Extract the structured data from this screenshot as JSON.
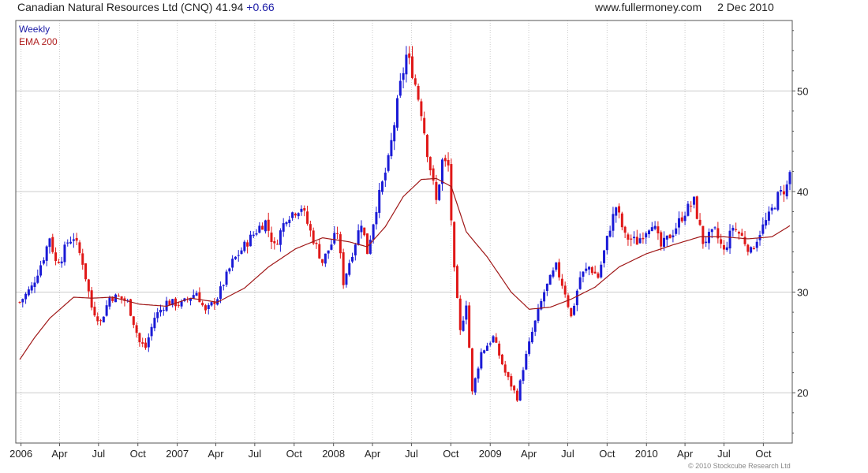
{
  "header": {
    "title": "Canadian Natural Resources Ltd (CNQ)",
    "price": "41.94",
    "change": "+0.66",
    "website": "www.fullermoney.com",
    "date": "2 Dec 2010"
  },
  "legend": {
    "weekly": "Weekly",
    "ema": "EMA 200"
  },
  "copyright": "© 2010 Stockcube Research Ltd",
  "colors": {
    "up": "#1a1ad6",
    "down": "#e01818",
    "ema": "#a01818",
    "grid": "#cccccc",
    "frame": "#555555"
  },
  "chart_data": {
    "type": "candlestick",
    "interval": "weekly",
    "x_range": [
      "2005-12-29",
      "2010-12-02"
    ],
    "ylim": [
      15,
      57
    ],
    "y_ticks": [
      20,
      30,
      40,
      50
    ],
    "y_axis_side": "right",
    "grid": true,
    "legend_position": "top-left",
    "x_ticks": [
      {
        "label": "2006",
        "date": "2006-01-01"
      },
      {
        "label": "Apr",
        "date": "2006-04-01"
      },
      {
        "label": "Jul",
        "date": "2006-07-01"
      },
      {
        "label": "Oct",
        "date": "2006-10-01"
      },
      {
        "label": "2007",
        "date": "2007-01-01"
      },
      {
        "label": "Apr",
        "date": "2007-04-01"
      },
      {
        "label": "Jul",
        "date": "2007-07-01"
      },
      {
        "label": "Oct",
        "date": "2007-10-01"
      },
      {
        "label": "2008",
        "date": "2008-01-01"
      },
      {
        "label": "Apr",
        "date": "2008-04-01"
      },
      {
        "label": "Jul",
        "date": "2008-07-01"
      },
      {
        "label": "Oct",
        "date": "2008-10-01"
      },
      {
        "label": "2009",
        "date": "2009-01-01"
      },
      {
        "label": "Apr",
        "date": "2009-04-01"
      },
      {
        "label": "Jul",
        "date": "2009-07-01"
      },
      {
        "label": "Oct",
        "date": "2009-10-01"
      },
      {
        "label": "2010",
        "date": "2010-01-01"
      },
      {
        "label": "Apr",
        "date": "2010-04-01"
      },
      {
        "label": "Jul",
        "date": "2010-07-01"
      },
      {
        "label": "Oct",
        "date": "2010-10-01"
      }
    ],
    "series": [
      {
        "name": "Weekly",
        "close_keypoints": [
          [
            "2005-12-29",
            29.0
          ],
          [
            "2006-01-26",
            30.5
          ],
          [
            "2006-02-23",
            33.5
          ],
          [
            "2006-03-09",
            35.5
          ],
          [
            "2006-03-23",
            33.0
          ],
          [
            "2006-04-06",
            33.5
          ],
          [
            "2006-04-20",
            35.0
          ],
          [
            "2006-05-04",
            35.5
          ],
          [
            "2006-05-25",
            33.0
          ],
          [
            "2006-06-15",
            28.5
          ],
          [
            "2006-07-06",
            27.0
          ],
          [
            "2006-07-27",
            29.5
          ],
          [
            "2006-08-17",
            29.5
          ],
          [
            "2006-09-07",
            29.0
          ],
          [
            "2006-09-21",
            27.0
          ],
          [
            "2006-10-05",
            25.0
          ],
          [
            "2006-10-19",
            24.5
          ],
          [
            "2006-11-09",
            27.5
          ],
          [
            "2006-12-07",
            29.0
          ],
          [
            "2007-01-11",
            28.8
          ],
          [
            "2007-02-15",
            30.0
          ],
          [
            "2007-03-08",
            28.0
          ],
          [
            "2007-04-05",
            29.5
          ],
          [
            "2007-05-10",
            33.0
          ],
          [
            "2007-06-14",
            35.0
          ],
          [
            "2007-07-12",
            36.5
          ],
          [
            "2007-07-26",
            37.0
          ],
          [
            "2007-08-16",
            34.5
          ],
          [
            "2007-09-13",
            37.5
          ],
          [
            "2007-10-18",
            38.5
          ],
          [
            "2007-11-08",
            36.0
          ],
          [
            "2007-12-06",
            33.0
          ],
          [
            "2008-01-10",
            36.0
          ],
          [
            "2008-01-24",
            31.0
          ],
          [
            "2008-02-14",
            34.0
          ],
          [
            "2008-03-06",
            37.0
          ],
          [
            "2008-03-20",
            34.0
          ],
          [
            "2008-04-10",
            38.5
          ],
          [
            "2008-05-08",
            43.0
          ],
          [
            "2008-06-05",
            50.5
          ],
          [
            "2008-06-19",
            53.5
          ],
          [
            "2008-07-03",
            52.0
          ],
          [
            "2008-07-24",
            48.0
          ],
          [
            "2008-08-07",
            44.0
          ],
          [
            "2008-08-28",
            39.0
          ],
          [
            "2008-09-11",
            43.0
          ],
          [
            "2008-09-25",
            42.5
          ],
          [
            "2008-10-09",
            32.0
          ],
          [
            "2008-10-23",
            26.0
          ],
          [
            "2008-11-06",
            29.0
          ],
          [
            "2008-11-20",
            20.0
          ],
          [
            "2008-12-11",
            24.0
          ],
          [
            "2009-01-08",
            25.5
          ],
          [
            "2009-02-05",
            22.0
          ],
          [
            "2009-03-05",
            19.5
          ],
          [
            "2009-03-19",
            22.5
          ],
          [
            "2009-04-09",
            26.0
          ],
          [
            "2009-05-07",
            30.0
          ],
          [
            "2009-06-04",
            32.5
          ],
          [
            "2009-06-25",
            30.0
          ],
          [
            "2009-07-09",
            27.5
          ],
          [
            "2009-07-30",
            31.5
          ],
          [
            "2009-08-20",
            32.5
          ],
          [
            "2009-09-10",
            31.5
          ],
          [
            "2009-10-08",
            36.5
          ],
          [
            "2009-10-22",
            38.5
          ],
          [
            "2009-11-12",
            35.5
          ],
          [
            "2009-12-10",
            35.0
          ],
          [
            "2010-01-14",
            37.0
          ],
          [
            "2010-02-04",
            34.5
          ],
          [
            "2010-03-04",
            36.0
          ],
          [
            "2010-04-01",
            38.0
          ],
          [
            "2010-04-22",
            39.0
          ],
          [
            "2010-05-13",
            35.0
          ],
          [
            "2010-06-10",
            36.0
          ],
          [
            "2010-07-01",
            34.0
          ],
          [
            "2010-07-22",
            36.5
          ],
          [
            "2010-08-12",
            35.5
          ],
          [
            "2010-09-02",
            34.0
          ],
          [
            "2010-09-23",
            36.0
          ],
          [
            "2010-10-14",
            37.5
          ],
          [
            "2010-11-04",
            39.5
          ],
          [
            "2010-11-25",
            40.5
          ],
          [
            "2010-12-02",
            41.94
          ]
        ]
      },
      {
        "name": "EMA 200",
        "keypoints": [
          [
            "2005-12-29",
            23.3
          ],
          [
            "2006-02-02",
            25.5
          ],
          [
            "2006-03-09",
            27.4
          ],
          [
            "2006-05-04",
            29.5
          ],
          [
            "2006-06-15",
            29.4
          ],
          [
            "2006-08-03",
            29.5
          ],
          [
            "2006-10-05",
            28.8
          ],
          [
            "2006-12-07",
            28.6
          ],
          [
            "2007-02-01",
            29.4
          ],
          [
            "2007-04-05",
            29.0
          ],
          [
            "2007-06-07",
            30.4
          ],
          [
            "2007-08-02",
            32.5
          ],
          [
            "2007-10-04",
            34.3
          ],
          [
            "2007-12-06",
            35.4
          ],
          [
            "2008-02-07",
            35.0
          ],
          [
            "2008-03-20",
            34.5
          ],
          [
            "2008-05-01",
            36.5
          ],
          [
            "2008-06-12",
            39.5
          ],
          [
            "2008-07-24",
            41.2
          ],
          [
            "2008-08-28",
            41.3
          ],
          [
            "2008-10-02",
            40.5
          ],
          [
            "2008-11-06",
            36.0
          ],
          [
            "2008-12-25",
            33.5
          ],
          [
            "2009-02-19",
            30.0
          ],
          [
            "2009-04-02",
            28.3
          ],
          [
            "2009-05-21",
            28.5
          ],
          [
            "2009-07-09",
            29.3
          ],
          [
            "2009-09-03",
            30.5
          ],
          [
            "2009-10-29",
            32.5
          ],
          [
            "2009-12-31",
            33.8
          ],
          [
            "2010-03-04",
            34.7
          ],
          [
            "2010-05-06",
            35.5
          ],
          [
            "2010-07-01",
            35.5
          ],
          [
            "2010-08-26",
            35.3
          ],
          [
            "2010-10-21",
            35.5
          ],
          [
            "2010-12-02",
            36.6
          ]
        ]
      }
    ]
  }
}
